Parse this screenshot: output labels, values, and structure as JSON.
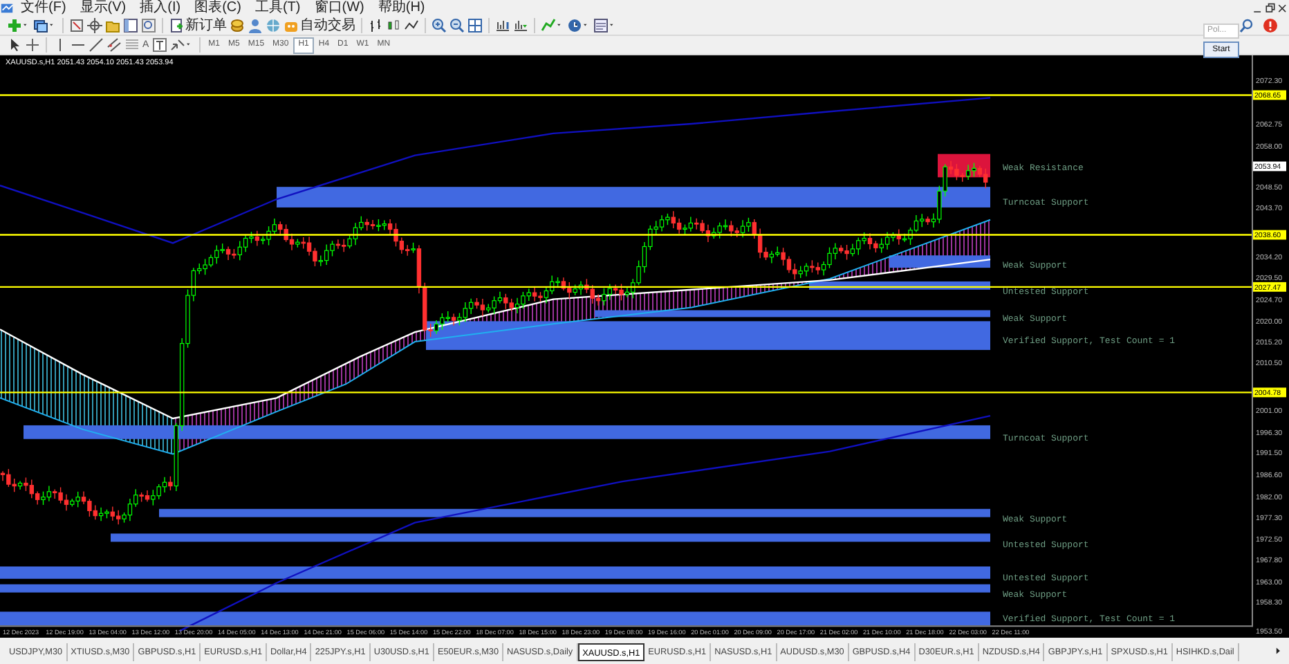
{
  "menu": [
    "文件(F)",
    "显示(V)",
    "插入(I)",
    "图表(C)",
    "工具(T)",
    "窗口(W)",
    "帮助(H)"
  ],
  "toolbar": {
    "order_button": "新订单",
    "autotrade_button": "自动交易",
    "text_tool": "A",
    "timeframes": [
      {
        "label": "M1",
        "selected": false
      },
      {
        "label": "M5",
        "selected": false
      },
      {
        "label": "M15",
        "selected": false
      },
      {
        "label": "M30",
        "selected": false
      },
      {
        "label": "H1",
        "selected": true
      },
      {
        "label": "H4",
        "selected": false
      },
      {
        "label": "D1",
        "selected": false
      },
      {
        "label": "W1",
        "selected": false
      },
      {
        "label": "MN",
        "selected": false
      }
    ]
  },
  "panel": {
    "dropdown": "Pol...",
    "button": "Start"
  },
  "chart": {
    "title": "XAUUSD.s,H1 2051.43 2054.10 2051.43 2053.94",
    "price_labels": [
      "2072.30",
      "2062.75",
      "2058.00",
      "2048.50",
      "2043.70",
      "2034.20",
      "2029.50",
      "2024.70",
      "2020.00",
      "2015.20",
      "2010.50",
      "2001.00",
      "1996.30",
      "1991.50",
      "1986.60",
      "1982.00",
      "1977.30",
      "1972.50",
      "1967.80",
      "1963.00",
      "1958.30",
      "1953.50"
    ],
    "level_lines": [
      "2068.65",
      "2038.60",
      "2027.47",
      "2004.78"
    ],
    "current_price": "2053.94",
    "time_labels": [
      "12 Dec 2023",
      "12 Dec 19:00",
      "13 Dec 04:00",
      "13 Dec 12:00",
      "13 Dec 20:00",
      "14 Dec 05:00",
      "14 Dec 13:00",
      "14 Dec 21:00",
      "15 Dec 06:00",
      "15 Dec 14:00",
      "15 Dec 22:00",
      "18 Dec 07:00",
      "18 Dec 15:00",
      "18 Dec 23:00",
      "19 Dec 08:00",
      "19 Dec 16:00",
      "20 Dec 01:00",
      "20 Dec 09:00",
      "20 Dec 17:00",
      "21 Dec 02:00",
      "21 Dec 10:00",
      "21 Dec 18:00",
      "22 Dec 03:00",
      "22 Dec 11:00"
    ],
    "zones": [
      {
        "label": "Weak Resistance",
        "kind": "resistance"
      },
      {
        "label": "Turncoat Support",
        "kind": "support"
      },
      {
        "label": "Weak Support",
        "kind": "support"
      },
      {
        "label": "Untested Support",
        "kind": "support"
      },
      {
        "label": "Weak Support",
        "kind": "support"
      },
      {
        "label": "Verified Support, Test Count = 1",
        "kind": "support"
      },
      {
        "label": "Turncoat Support",
        "kind": "support"
      },
      {
        "label": "Weak Support",
        "kind": "support"
      },
      {
        "label": "Untested Support",
        "kind": "support"
      },
      {
        "label": "Untested Support",
        "kind": "support"
      },
      {
        "label": "Weak Support",
        "kind": "support"
      },
      {
        "label": "Verified Support, Test Count = 1",
        "kind": "support"
      }
    ]
  },
  "tabs": [
    {
      "label": "USDJPY,M30",
      "selected": false
    },
    {
      "label": "XTIUSD.s,M30",
      "selected": false
    },
    {
      "label": "GBPUSD.s,H1",
      "selected": false
    },
    {
      "label": "EURUSD.s,H1",
      "selected": false
    },
    {
      "label": "Dollar,H4",
      "selected": false
    },
    {
      "label": "225JPY.s,H1",
      "selected": false
    },
    {
      "label": "U30USD.s,H1",
      "selected": false
    },
    {
      "label": "E50EUR.s,M30",
      "selected": false
    },
    {
      "label": "NASUSD.s,Daily",
      "selected": false
    },
    {
      "label": "XAUUSD.s,H1",
      "selected": true
    },
    {
      "label": "EURUSD.s,H1",
      "selected": false
    },
    {
      "label": "NASUSD.s,H1",
      "selected": false
    },
    {
      "label": "AUDUSD.s,M30",
      "selected": false
    },
    {
      "label": "GBPUSD.s,H4",
      "selected": false
    },
    {
      "label": "D30EUR.s,H1",
      "selected": false
    },
    {
      "label": "NZDUSD.s,H4",
      "selected": false
    },
    {
      "label": "GBPJPY.s,H1",
      "selected": false
    },
    {
      "label": "SPXUSD.s,H1",
      "selected": false
    },
    {
      "label": "HSIHKD.s,Dail",
      "selected": false
    }
  ]
}
